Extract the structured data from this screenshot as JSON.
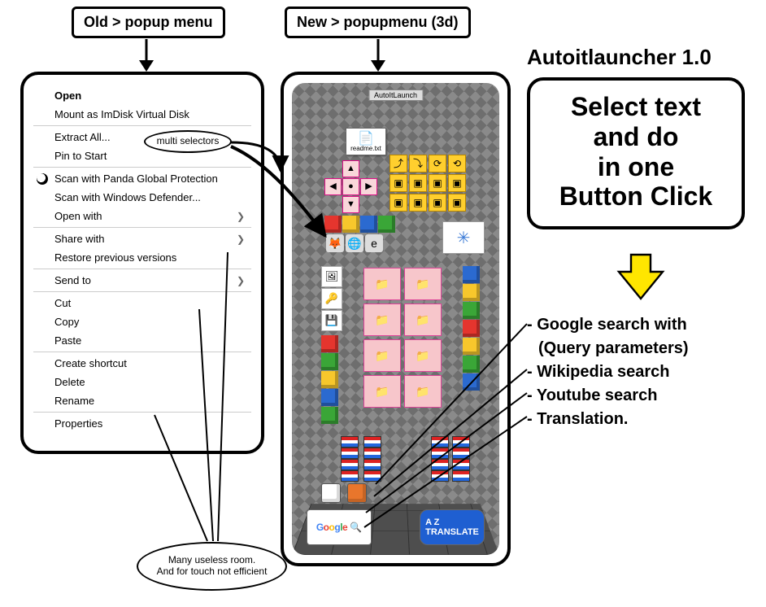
{
  "labels": {
    "old": "Old > popup menu",
    "new": "New > popupmenu (3d)"
  },
  "multi_selectors": "multi selectors",
  "useless_room": "Many useless room.\nAnd for touch not efficient",
  "title": "Autoitlauncher 1.0",
  "promo": {
    "l1": "Select text",
    "l2": "and do",
    "l3": "in one",
    "l4": "Button Click"
  },
  "features": {
    "f1": "- Google search with",
    "f1b": "(Query parameters)",
    "f2": "- Wikipedia search",
    "f3": "- Youtube search",
    "f4": "- Translation."
  },
  "classic_menu": {
    "items": [
      {
        "label": "Open",
        "bold": true
      },
      {
        "label": "Mount as ImDisk Virtual Disk"
      },
      {
        "sep": true
      },
      {
        "label": "Extract All..."
      },
      {
        "label": "Pin to Start"
      },
      {
        "sep": true
      },
      {
        "label": "Scan with Panda Global Protection",
        "icon": "panda"
      },
      {
        "label": "Scan with Windows Defender..."
      },
      {
        "label": "Open with",
        "sub": true
      },
      {
        "sep": true
      },
      {
        "label": "Share with",
        "sub": true
      },
      {
        "label": "Restore previous versions"
      },
      {
        "sep": true
      },
      {
        "label": "Send to",
        "sub": true
      },
      {
        "sep": true
      },
      {
        "label": "Cut"
      },
      {
        "label": "Copy"
      },
      {
        "label": "Paste"
      },
      {
        "sep": true
      },
      {
        "label": "Create shortcut"
      },
      {
        "label": "Delete"
      },
      {
        "label": "Rename"
      },
      {
        "sep": true
      },
      {
        "label": "Properties"
      }
    ]
  },
  "scene": {
    "title": "AutoItLaunch",
    "readme": "readme.txt",
    "google": "Google",
    "az": "A Z\nTRANSLATE"
  }
}
